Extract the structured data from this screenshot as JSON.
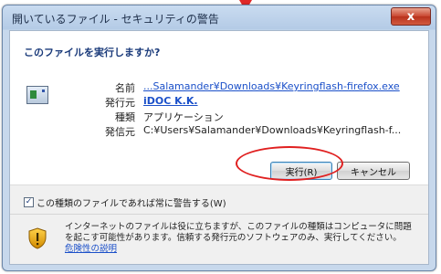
{
  "window": {
    "title": "開いているファイル - セキュリティの警告",
    "close_label": "x"
  },
  "top_fragment": "…",
  "prompt": {
    "question": "このファイルを実行しますか?",
    "fields": [
      {
        "label": "名前",
        "value": "...Salamander¥Downloads¥Keyringflash-firefox.exe",
        "link": true,
        "bold": false
      },
      {
        "label": "発行元",
        "value": "iDOC K.K.",
        "link": true,
        "bold": true
      },
      {
        "label": "種類",
        "value": "アプリケーション",
        "link": false,
        "bold": false
      },
      {
        "label": "発信元",
        "value": "C:¥Users¥Salamander¥Downloads¥Keyringflash-f...",
        "link": false,
        "bold": false
      }
    ]
  },
  "buttons": {
    "run_label": "実行(R)",
    "cancel_label": "キャンセル"
  },
  "checkbox": {
    "label": "この種類のファイルであれば常に警告する(W)",
    "checked": true
  },
  "warning": {
    "text": "インターネットのファイルは役に立ちますが、このファイルの種類はコンピュータに問題を起こす可能性があります。信頼する発行元のソフトウェアのみ、実行してください。",
    "link_label": "危険性の説明"
  },
  "colors": {
    "annotation_red": "#e02020",
    "link_blue": "#1b50c9",
    "heading_blue": "#1a3a7a"
  },
  "icons": [
    "application-file-icon",
    "security-shield-icon",
    "close-icon"
  ]
}
